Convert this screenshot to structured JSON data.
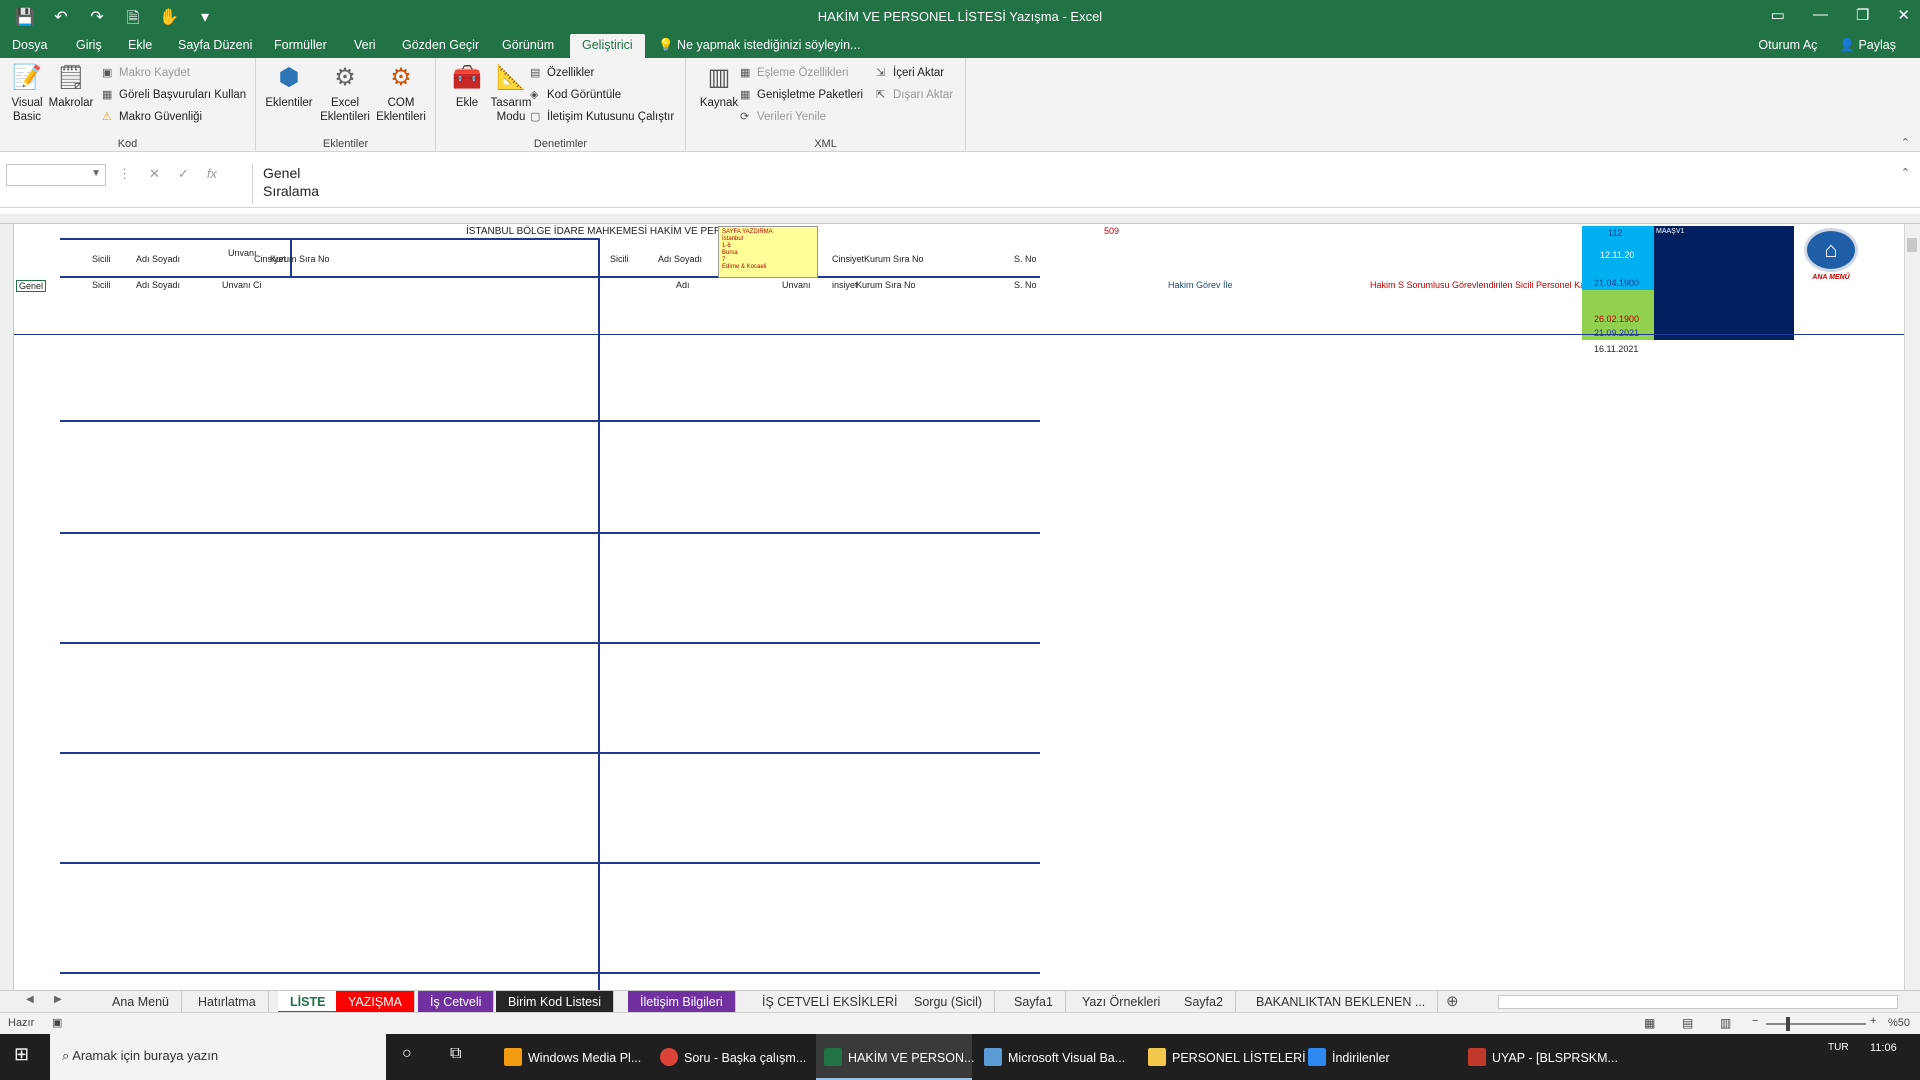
{
  "window": {
    "title": "HAKİM VE PERSONEL LİSTESİ Yazışma - Excel"
  },
  "qat": {
    "save": "💾",
    "undo": "↶",
    "redo": "↷",
    "preview": "🗎",
    "touch": "✋",
    "more": "▾"
  },
  "menu_tabs": [
    "Dosya",
    "Giriş",
    "Ekle",
    "Sayfa Düzeni",
    "Formüller",
    "Veri",
    "Gözden Geçir",
    "Görünüm",
    "Geliştirici"
  ],
  "tell_me": "Ne yapmak istediğinizi söyleyin...",
  "account": {
    "signin": "Oturum Aç",
    "share": "Paylaş"
  },
  "ribbon": {
    "kod": {
      "label": "Kod",
      "visual_basic": "Visual Basic",
      "macros": "Makrolar",
      "record_macro": "Makro Kaydet",
      "relative_refs": "Göreli Başvuruları Kullan",
      "macro_security": "Makro Güvenliği"
    },
    "eklentiler": {
      "label": "Eklentiler",
      "addins": "Eklentiler",
      "excel_addins": "Excel Eklentileri",
      "com_addins": "COM Eklentileri"
    },
    "denetimler": {
      "label": "Denetimler",
      "insert": "Ekle",
      "design_mode": "Tasarım Modu",
      "properties": "Özellikler",
      "view_code": "Kod Görüntüle",
      "run_dialog": "İletişim Kutusunu Çalıştır"
    },
    "xml": {
      "label": "XML",
      "source": "Kaynak",
      "map_props": "Eşleme Özellikleri",
      "expansion_packs": "Genişletme Paketleri",
      "refresh_data": "Verileri Yenile",
      "import": "İçeri Aktar",
      "export": "Dışarı Aktar"
    }
  },
  "formula": {
    "line1": "Genel",
    "line2": "Sıralama"
  },
  "sheet": {
    "title": "İSTANBUL BÖLGE İDARE MAHKEMESİ HAKİM VE PERSO",
    "header_left": [
      "Sicili",
      "Adı Soyadı",
      "Unvanı",
      "Cinsiyet",
      "Kurum Sıra No"
    ],
    "header_mid": [
      "Sicili",
      "Adı Soyadı"
    ],
    "header_right": [
      "Cinsiyet",
      "Kurum Sıra No",
      "S. No"
    ],
    "row4": [
      "Genel",
      "Sicili",
      "Adı Soyadı",
      "Unvanı Ci",
      "Adı",
      "Unvanı",
      "insiyet",
      "Kurum Sıra No",
      "S. No"
    ],
    "yellow_note": [
      "SAYFA YAZDIRMA",
      "İstanbul",
      "1-6",
      "Bursa",
      "7",
      "Edirne & Kocaeli"
    ],
    "top_numbers": {
      "a": "509",
      "b": "112",
      "c": "12.11.20",
      "d": "21.04.1900",
      "e": "26.02.1900",
      "f": "21.09.2021",
      "g": "16.11.2021"
    },
    "hakim_gorev": "Hakim Görev İle",
    "hakim_s": "Hakim S Sorumlusu Görevlendirilen Sicili Personel Kaydı",
    "home_button": "ANA MENÜ",
    "maasv": "MAAŞV1"
  },
  "sheet_tabs": [
    {
      "label": "Ana Menü",
      "bg": "#f0f0f0",
      "fg": "#333333"
    },
    {
      "label": "Hatırlatma",
      "bg": "#f0f0f0",
      "fg": "#333333"
    },
    {
      "label": "LİSTE",
      "bg": "#ffffff",
      "fg": "#217346"
    },
    {
      "label": "YAZIŞMA",
      "bg": "#ff0000",
      "fg": "#ffffff"
    },
    {
      "label": "İş Cetveli",
      "bg": "#7030a0",
      "fg": "#ffffff"
    },
    {
      "label": "Birim Kod Listesi",
      "bg": "#262626",
      "fg": "#ffffff"
    },
    {
      "label": "İletişim Bilgileri",
      "bg": "#7030a0",
      "fg": "#ffffff"
    },
    {
      "label": "İŞ CETVELİ EKSİKLERİ",
      "bg": "#f0f0f0",
      "fg": "#333333"
    },
    {
      "label": "Sorgu (Sicil)",
      "bg": "#f0f0f0",
      "fg": "#333333"
    },
    {
      "label": "Sayfa1",
      "bg": "#f0f0f0",
      "fg": "#333333"
    },
    {
      "label": "Yazı Örnekleri",
      "bg": "#f0f0f0",
      "fg": "#333333"
    },
    {
      "label": "Sayfa2",
      "bg": "#f0f0f0",
      "fg": "#333333"
    },
    {
      "label": "BAKANLIKTAN BEKLENEN ...",
      "bg": "#f0f0f0",
      "fg": "#333333"
    }
  ],
  "status": {
    "ready": "Hazır",
    "zoom": "%50"
  },
  "taskbar": {
    "search": "Aramak için buraya yazın",
    "apps": [
      "Windows Media Pl...",
      "Soru - Başka çalışm...",
      "HAKİM VE PERSON...",
      "Microsoft Visual Ba...",
      "PERSONEL LİSTELERİ",
      "İndirilenler",
      "UYAP - [BLSPRSKM..."
    ],
    "lang": "TUR",
    "time": "11:06"
  },
  "colors": {
    "excel_green": "#217346",
    "navy": "#1f3a93",
    "cyan": "#00b0f0",
    "dark_navy": "#002060"
  }
}
